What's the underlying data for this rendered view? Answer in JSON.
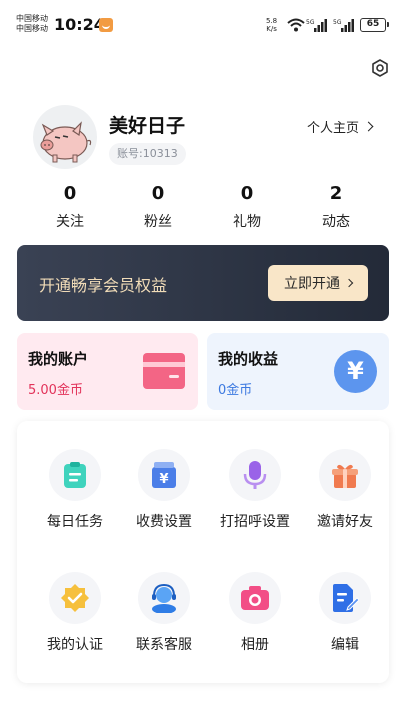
{
  "status_bar": {
    "carrier_1": "中国移动",
    "carrier_2": "中国移动",
    "time": "10:24",
    "speed_value": "5.8",
    "speed_unit": "K/s",
    "battery": "65"
  },
  "profile": {
    "nickname": "美好日子",
    "account_id": "账号:10313",
    "homepage_link": "个人主页"
  },
  "stats": [
    {
      "value": "0",
      "label": "关注"
    },
    {
      "value": "0",
      "label": "粉丝"
    },
    {
      "value": "0",
      "label": "礼物"
    },
    {
      "value": "2",
      "label": "动态"
    }
  ],
  "vip_banner": {
    "text": "开通畅享会员权益",
    "button": "立即开通"
  },
  "account_card": {
    "title": "我的账户",
    "value": "5.00金币"
  },
  "income_card": {
    "title": "我的收益",
    "value": "0金币"
  },
  "grid": [
    {
      "label": "每日任务",
      "icon": "clipboard-icon"
    },
    {
      "label": "收费设置",
      "icon": "yuan-box-icon"
    },
    {
      "label": "打招呼设置",
      "icon": "microphone-icon"
    },
    {
      "label": "邀请好友",
      "icon": "gift-icon"
    },
    {
      "label": "我的认证",
      "icon": "verified-badge-icon"
    },
    {
      "label": "联系客服",
      "icon": "customer-service-icon"
    },
    {
      "label": "相册",
      "icon": "camera-icon"
    },
    {
      "label": "编辑",
      "icon": "edit-document-icon"
    }
  ],
  "colors": {
    "vip_text": "#f1dcb8",
    "vip_button": "#f9e6c8",
    "account_value": "#e2335a",
    "income_value": "#3c79e0",
    "wallet": "#f36585",
    "yuan": "#5c95ee"
  }
}
